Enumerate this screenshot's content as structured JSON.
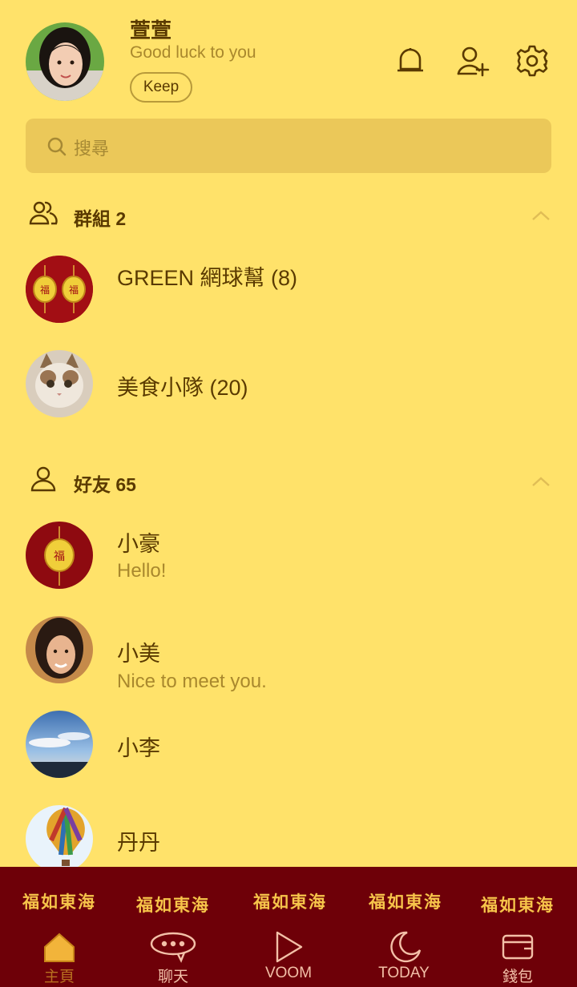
{
  "profile": {
    "name": "萱萱",
    "status": "Good luck to you",
    "keep_label": "Keep"
  },
  "header_icons": [
    "bell-icon",
    "add-friend-icon",
    "settings-icon"
  ],
  "search": {
    "placeholder": "搜尋"
  },
  "groups": {
    "title": "群組 2",
    "items": [
      {
        "name": "GREEN 網球幫 (8)"
      },
      {
        "name": "美食小隊 (20)"
      }
    ]
  },
  "friends": {
    "title": "好友 65",
    "items": [
      {
        "name": "小豪",
        "status": "Hello!"
      },
      {
        "name": "小美",
        "status": "Nice to meet you."
      },
      {
        "name": "小李",
        "status": ""
      },
      {
        "name": "丹丹",
        "status": ""
      }
    ]
  },
  "decoration": {
    "motif": "福如東海"
  },
  "bottom_nav": [
    {
      "label": "主頁",
      "icon": "home-icon",
      "active": true
    },
    {
      "label": "聊天",
      "icon": "chat-icon"
    },
    {
      "label": "VOOM",
      "icon": "play-icon"
    },
    {
      "label": "TODAY",
      "icon": "moon-icon"
    },
    {
      "label": "錢包",
      "icon": "wallet-icon"
    }
  ],
  "colors": {
    "background": "#ffe26a",
    "search_bg": "#ebc859",
    "text": "#5a3a00",
    "subtext": "#a9882d",
    "bottom_bar": "#6e0008",
    "motif": "#f6c44a"
  }
}
